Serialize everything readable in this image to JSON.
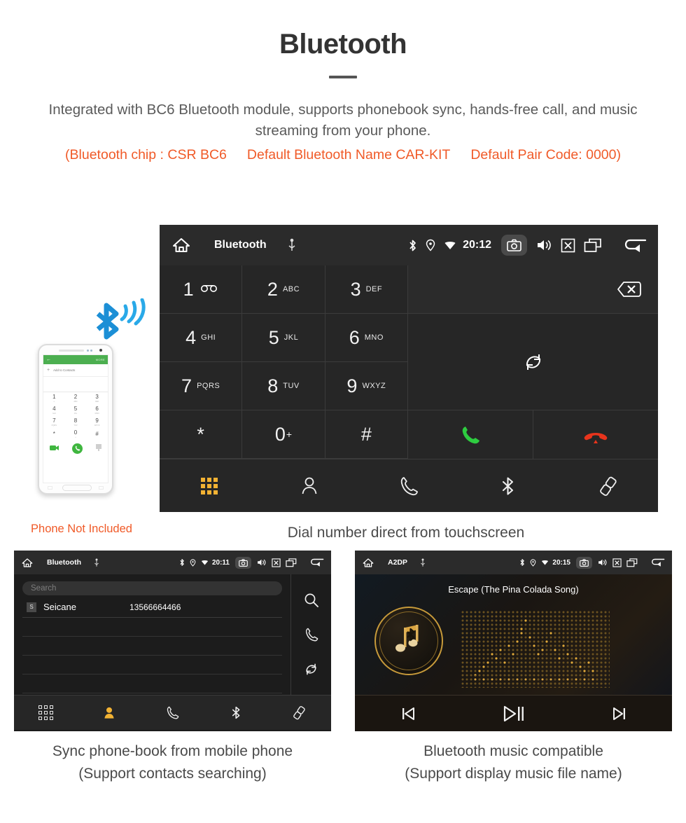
{
  "header": {
    "title": "Bluetooth",
    "description": "Integrated with BC6 Bluetooth module, supports phonebook sync, hands-free call, and music streaming from your phone.",
    "spec_chip": "(Bluetooth chip : CSR BC6",
    "spec_name": "Default Bluetooth Name CAR-KIT",
    "spec_pair": "Default Pair Code: 0000)",
    "accent_color": "#f05a28",
    "text_color": "#5a5a5a"
  },
  "dialer_screen": {
    "statusbar": {
      "home_icon": "home-icon",
      "title": "Bluetooth",
      "usb_icon": "usb-icon",
      "bluetooth_icon": "bluetooth-icon",
      "location_icon": "location-pin-icon",
      "wifi_icon": "wifi-icon",
      "time": "20:12",
      "camera_icon": "camera-icon",
      "volume_icon": "volume-icon",
      "close_icon": "close-box-icon",
      "recents_icon": "recents-icon",
      "back_icon": "back-arrow-icon"
    },
    "keys": [
      {
        "num": "1",
        "sub": "",
        "voicemail": true
      },
      {
        "num": "2",
        "sub": "ABC"
      },
      {
        "num": "3",
        "sub": "DEF"
      },
      {
        "num": "4",
        "sub": "GHI"
      },
      {
        "num": "5",
        "sub": "JKL"
      },
      {
        "num": "6",
        "sub": "MNO"
      },
      {
        "num": "7",
        "sub": "PQRS"
      },
      {
        "num": "8",
        "sub": "TUV"
      },
      {
        "num": "9",
        "sub": "WXYZ"
      },
      {
        "num": "*",
        "sub": ""
      },
      {
        "num": "0",
        "sup": "+",
        "sub": ""
      },
      {
        "num": "#",
        "sub": ""
      }
    ],
    "right_panel": {
      "backspace_icon": "backspace-icon",
      "sync_icon": "sync-icon",
      "call_icon": "call-icon",
      "hangup_icon": "hangup-icon",
      "call_color": "#2ecc40",
      "hangup_color": "#e8341c"
    },
    "bottom_nav": [
      {
        "icon": "keypad-grid-icon",
        "active": true
      },
      {
        "icon": "contacts-person-icon",
        "active": false
      },
      {
        "icon": "call-history-icon",
        "active": false
      },
      {
        "icon": "bluetooth-icon",
        "active": false
      },
      {
        "icon": "pair-link-icon",
        "active": false
      }
    ],
    "active_color": "#f2b233",
    "caption": "Dial number direct from touchscreen"
  },
  "phone_mockup": {
    "header_back_icon": "back-arrow-icon",
    "header_more": "MORE",
    "add_contact_label": "Add to Contacts",
    "keys": [
      {
        "n": "1",
        "s": "∞"
      },
      {
        "n": "2",
        "s": "ABC"
      },
      {
        "n": "3",
        "s": "DEF"
      },
      {
        "n": "4",
        "s": "GHI"
      },
      {
        "n": "5",
        "s": "JKL"
      },
      {
        "n": "6",
        "s": "MNO"
      },
      {
        "n": "7",
        "s": "PQRS"
      },
      {
        "n": "8",
        "s": "TUV"
      },
      {
        "n": "9",
        "s": "WXYZ"
      },
      {
        "n": "*",
        "s": ""
      },
      {
        "n": "0",
        "s": "+"
      },
      {
        "n": "#",
        "s": ""
      }
    ],
    "note": "Phone Not Included",
    "note_color": "#f05a28",
    "bluetooth_signal_icon": "bluetooth-signal-icon"
  },
  "phonebook_screen": {
    "statusbar": {
      "title": "Bluetooth",
      "time": "20:11"
    },
    "search_placeholder": "Search",
    "contacts": [
      {
        "initial": "S",
        "name": "Seicane",
        "number": "13566664466"
      }
    ],
    "rail": [
      {
        "icon": "search-icon"
      },
      {
        "icon": "call-icon"
      },
      {
        "icon": "sync-icon"
      }
    ],
    "bottom_nav": [
      {
        "icon": "keypad-grid-icon",
        "active": false
      },
      {
        "icon": "contacts-person-icon",
        "active": true
      },
      {
        "icon": "call-history-icon",
        "active": false
      },
      {
        "icon": "bluetooth-icon",
        "active": false
      },
      {
        "icon": "pair-link-icon",
        "active": false
      }
    ],
    "caption_line1": "Sync phone-book from mobile phone",
    "caption_line2": "(Support contacts searching)"
  },
  "music_screen": {
    "statusbar": {
      "title": "A2DP",
      "time": "20:15"
    },
    "track_name": "Escape (The Pina Colada Song)",
    "album_icon": "music-note-bluetooth-icon",
    "visualizer": "dot-matrix-equalizer",
    "controls": [
      {
        "icon": "previous-track-icon"
      },
      {
        "icon": "play-pause-icon"
      },
      {
        "icon": "next-track-icon"
      }
    ],
    "accent_color": "#d9a441",
    "caption_line1": "Bluetooth music compatible",
    "caption_line2": "(Support display music file name)"
  }
}
